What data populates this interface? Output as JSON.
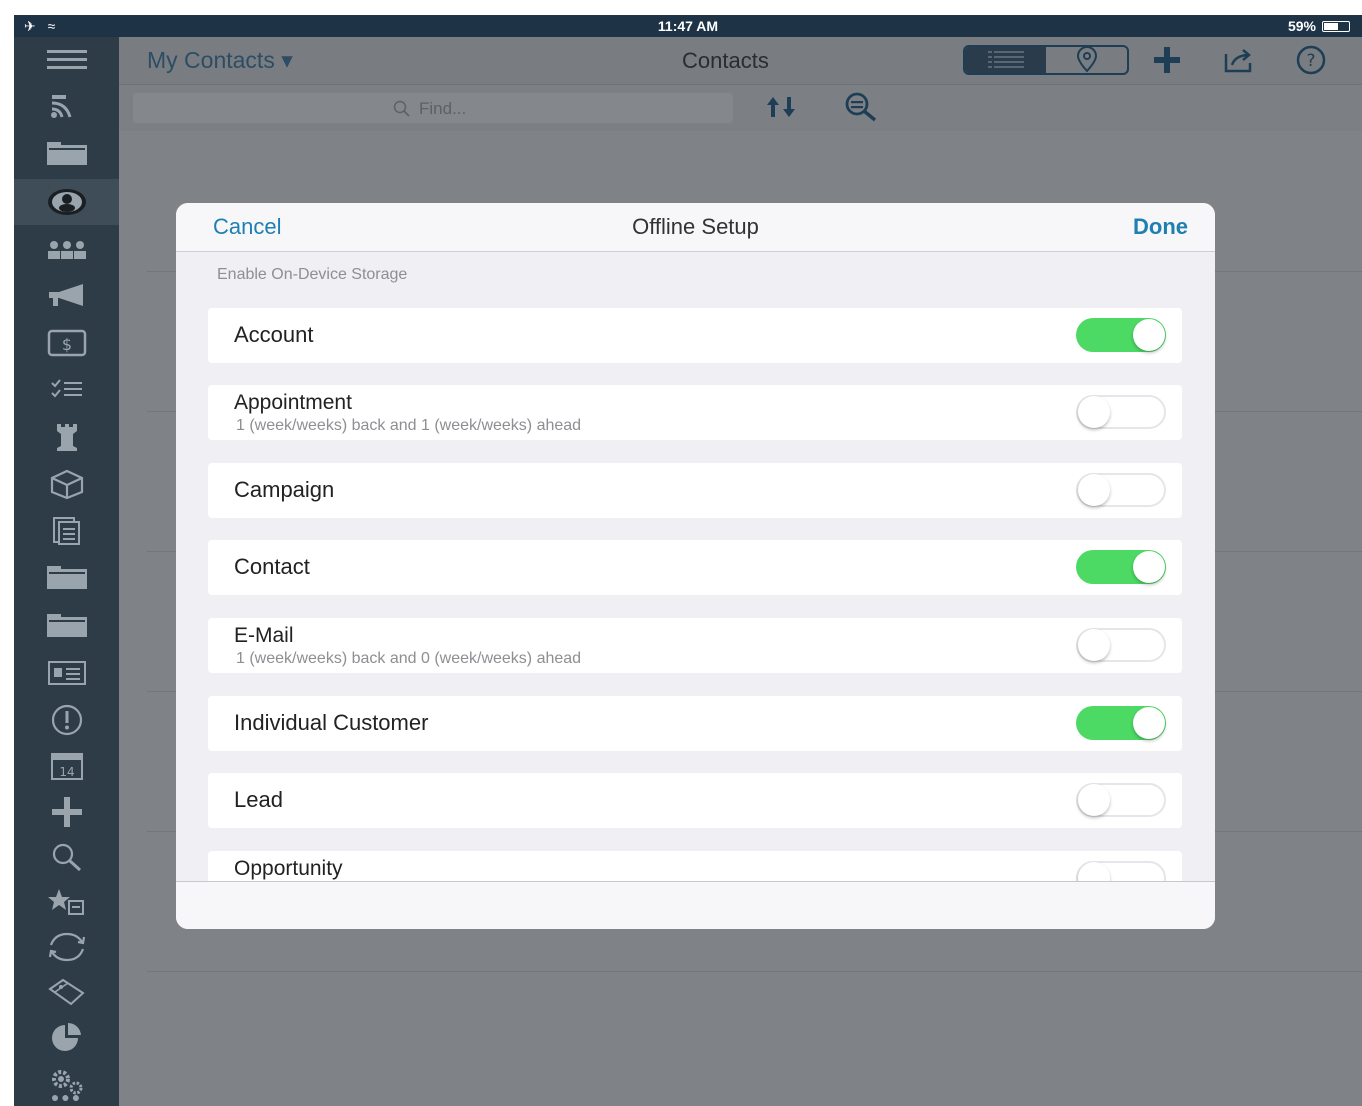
{
  "status_bar": {
    "time": "11:47 AM",
    "battery": "59%"
  },
  "nav": {
    "title": "My Contacts ▾",
    "center_title": "Contacts"
  },
  "search": {
    "placeholder": "Find..."
  },
  "modal": {
    "cancel": "Cancel",
    "title": "Offline Setup",
    "done": "Done",
    "section_label": "Enable On-Device Storage",
    "rows": [
      {
        "label": "Account",
        "subtitle": "",
        "enabled": true
      },
      {
        "label": "Appointment",
        "subtitle": "1 (week/weeks) back and 1 (week/weeks) ahead",
        "enabled": false
      },
      {
        "label": "Campaign",
        "subtitle": "",
        "enabled": false
      },
      {
        "label": "Contact",
        "subtitle": "",
        "enabled": true
      },
      {
        "label": "E-Mail",
        "subtitle": "1 (week/weeks) back and 0 (week/weeks) ahead",
        "enabled": false
      },
      {
        "label": "Individual Customer",
        "subtitle": "",
        "enabled": true
      },
      {
        "label": "Lead",
        "subtitle": "",
        "enabled": false
      },
      {
        "label": "Opportunity",
        "subtitle": "",
        "enabled": false
      }
    ]
  },
  "colors": {
    "toggle_on": "#4cd964",
    "accent": "#1f7fb0",
    "sidebar": "#2e3c48",
    "status_bar": "#1f3347"
  },
  "icons": {
    "sidebar": [
      "menu-icon",
      "feed-icon",
      "folder-icon",
      "contacts-icon",
      "groups-icon",
      "megaphone-icon",
      "dollar-icon",
      "checklist-icon",
      "tower-icon",
      "box-icon",
      "documents-icon",
      "folder-icon",
      "folder-icon",
      "id-card-icon",
      "alert-icon",
      "calendar-icon",
      "plus-icon",
      "search-icon",
      "favorites-icon",
      "sync-icon",
      "tag-icon",
      "pie-chart-icon",
      "settings-icon"
    ]
  }
}
